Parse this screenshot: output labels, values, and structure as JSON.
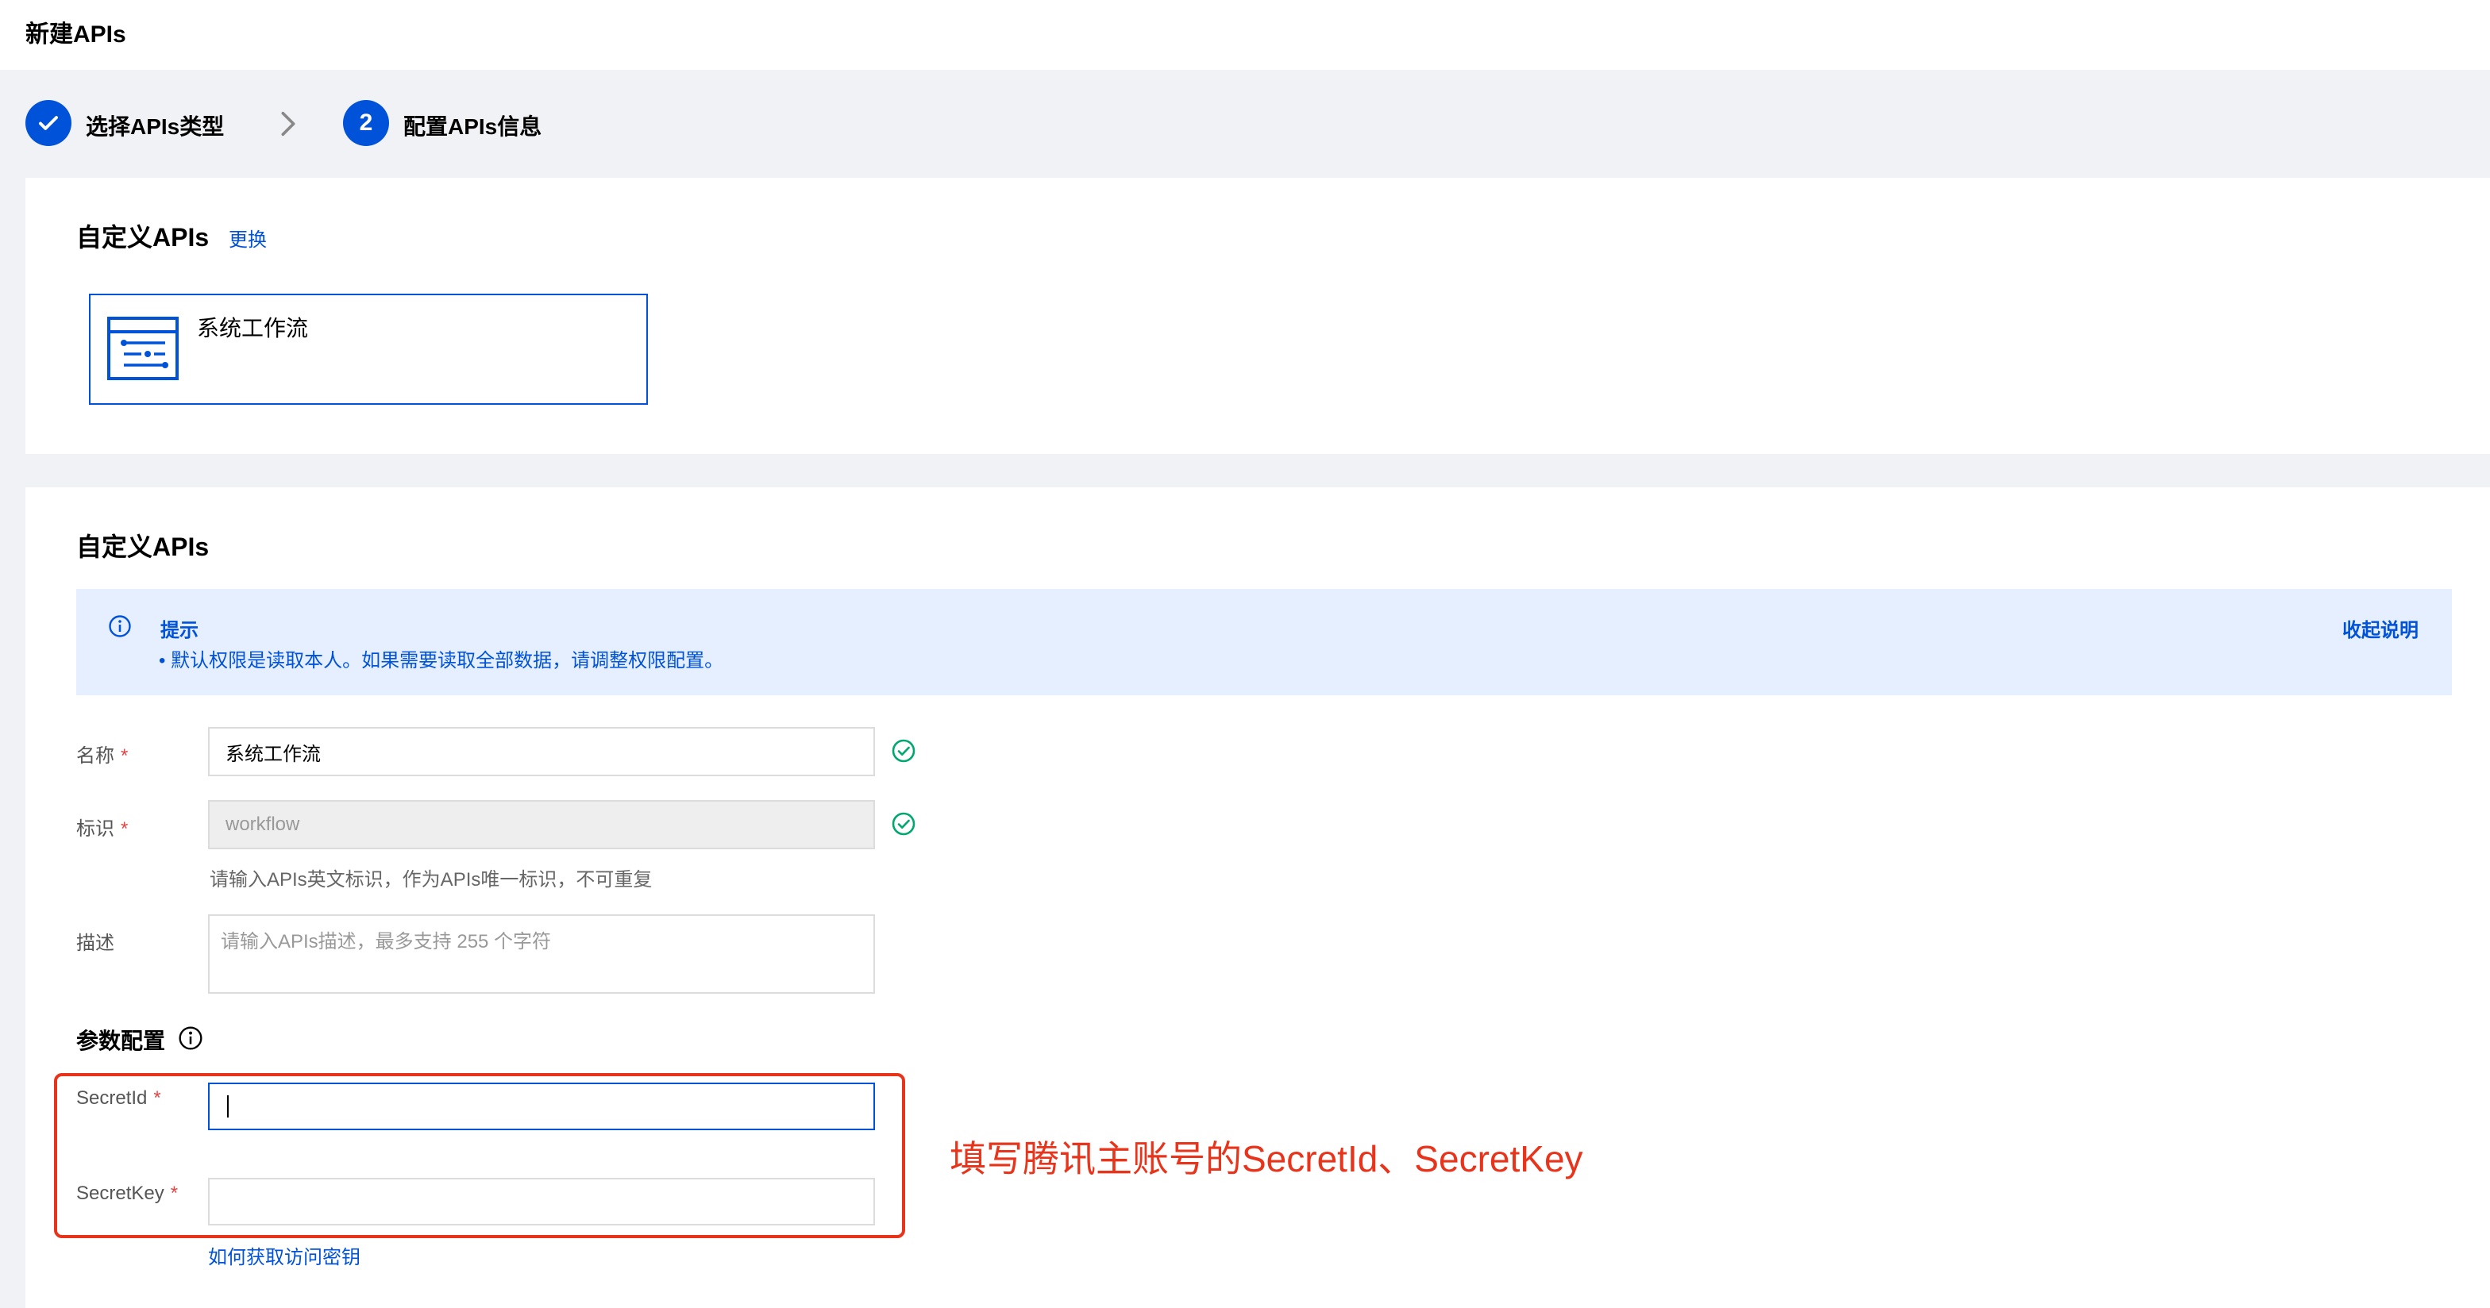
{
  "header": {
    "title": "新建APIs"
  },
  "steps": [
    {
      "label": "选择APIs类型",
      "state": "done"
    },
    {
      "number": "2",
      "label": "配置APIs信息",
      "state": "active"
    }
  ],
  "section1": {
    "title": "自定义APIs",
    "change_link": "更换",
    "selected_type": "系统工作流"
  },
  "section2": {
    "title": "自定义APIs",
    "notice": {
      "title": "提示",
      "text": "• 默认权限是读取本人。如果需要读取全部数据，请调整权限配置。",
      "collapse_label": "收起说明"
    },
    "fields": {
      "name": {
        "label": "名称",
        "required": "*",
        "value": "系统工作流"
      },
      "identifier": {
        "label": "标识",
        "required": "*",
        "value": "workflow",
        "hint": "请输入APIs英文标识，作为APIs唯一标识，不可重复"
      },
      "description": {
        "label": "描述",
        "placeholder": "请输入APIs描述，最多支持 255 个字符"
      }
    },
    "params": {
      "title": "参数配置",
      "secret_id": {
        "label": "SecretId",
        "required": "*",
        "value": ""
      },
      "secret_key": {
        "label": "SecretKey",
        "required": "*",
        "value": ""
      },
      "help_link": "如何获取访问密钥"
    }
  },
  "annotation": "填写腾讯主账号的SecretId、SecretKey",
  "colors": {
    "primary": "#0052d9",
    "success": "#00a870",
    "annotation": "#e8341b",
    "notice_bg": "#e6efff"
  }
}
